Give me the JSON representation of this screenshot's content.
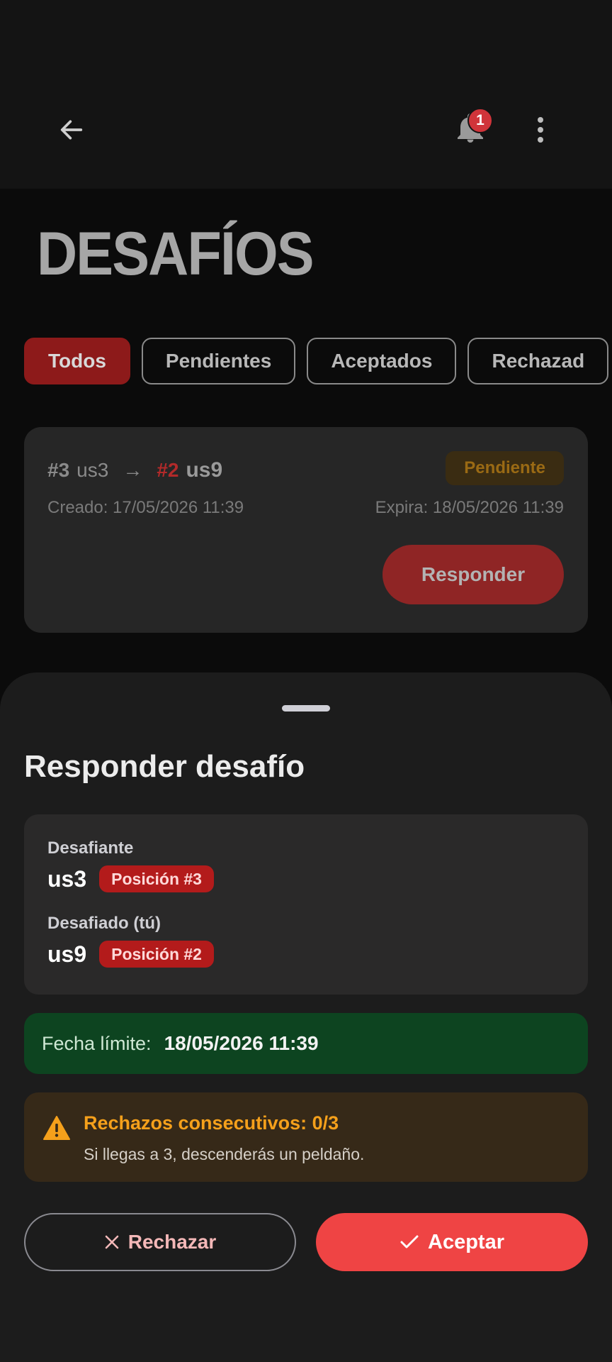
{
  "header": {
    "back_icon": "arrow-left-icon",
    "notification_icon": "bell-icon",
    "notification_count": "1",
    "more_icon": "more-vertical-icon"
  },
  "page": {
    "title": "DESAFÍOS"
  },
  "filters": [
    {
      "label": "Todos",
      "active": true
    },
    {
      "label": "Pendientes",
      "active": false
    },
    {
      "label": "Aceptados",
      "active": false
    },
    {
      "label": "Rechazad",
      "active": false
    }
  ],
  "challenge": {
    "challenger_rank": "#3",
    "challenger_name": "us3",
    "arrow": "→",
    "challenged_rank": "#2",
    "challenged_name": "us9",
    "status": "Pendiente",
    "created": "Creado: 17/05/2026 11:39",
    "expires": "Expira: 18/05/2026 11:39",
    "respond_label": "Responder"
  },
  "sheet": {
    "title": "Responder desafío",
    "challenger_label": "Desafiante",
    "challenger_name": "us3",
    "challenger_position": "Posición #3",
    "challenged_label": "Desafiado (tú)",
    "challenged_name": "us9",
    "challenged_position": "Posición #2",
    "deadline_label": "Fecha límite:",
    "deadline_value": "18/05/2026 11:39",
    "warning_title": "Rechazos consecutivos: 0/3",
    "warning_text": "Si llegas a 3, descenderás un peldaño.",
    "reject_label": "Rechazar",
    "accept_label": "Aceptar"
  },
  "colors": {
    "accent_red": "#ef4444",
    "active_chip": "#8d1a1a",
    "deadline_bg": "#0d4420",
    "warning_bg": "#362918",
    "warning_text": "#f5a01b"
  }
}
